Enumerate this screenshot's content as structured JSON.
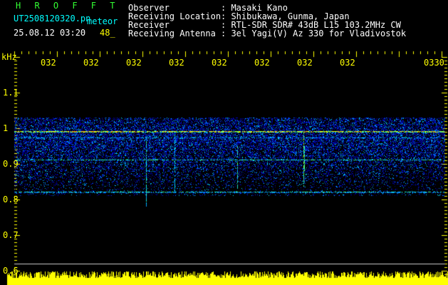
{
  "header": {
    "software": "H R O F F T",
    "filename": "UT2508120320.pn",
    "mode": "meteor",
    "date_time": "25.08.12 03:20",
    "count": "48_"
  },
  "station_info": [
    {
      "label": "Observer",
      "value": ": Masaki Kano"
    },
    {
      "label": "Receiving Location",
      "value": ": Shibukawa, Gunma, Japan"
    },
    {
      "label": "Receiver",
      "value": ": RTL-SDR SDR# 43dB L15 103.2MHz CW"
    },
    {
      "label": "Receiving Antenna",
      "value": ": 3el Yagi(V) Az 330 for Vladivostok"
    }
  ],
  "axis": {
    "unit": "kHz",
    "y_ticks": [
      "1.1",
      "1",
      "0.9",
      "0.8",
      "0.7",
      "0.6"
    ],
    "time_labels": [
      "032",
      "032",
      "032",
      "032",
      "032",
      "032",
      "032",
      "032",
      "0330"
    ]
  },
  "colors": {
    "background": "#000000",
    "title": "#33ff33",
    "info": "#ffffff",
    "file": "#00ffff",
    "axis": "#ffff00"
  }
}
